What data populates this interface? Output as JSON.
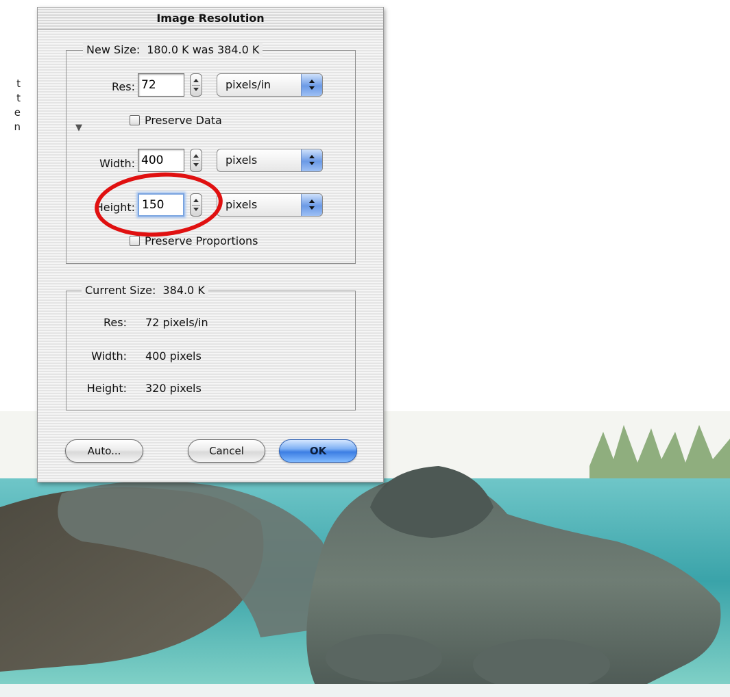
{
  "dialog": {
    "title": "Image Resolution",
    "new_size": {
      "legend_prefix": "New Size:",
      "legend_value": "180.0 K was 384.0 K",
      "res_label": "Res:",
      "res_value": "72",
      "res_unit": "pixels/in",
      "preserve_data_label": "Preserve Data",
      "preserve_data_checked": false,
      "width_label": "Width:",
      "width_value": "400",
      "width_unit": "pixels",
      "height_label": "Height:",
      "height_value": "150",
      "height_unit": "pixels",
      "preserve_proportions_label": "Preserve Proportions",
      "preserve_proportions_checked": false
    },
    "current_size": {
      "legend_prefix": "Current Size:",
      "legend_value": "384.0 K",
      "res_label": "Res:",
      "res_value": "72 pixels/in",
      "width_label": "Width:",
      "width_value": "400 pixels",
      "height_label": "Height:",
      "height_value": "320 pixels"
    },
    "buttons": {
      "auto": "Auto...",
      "cancel": "Cancel",
      "ok": "OK"
    }
  },
  "annotation": {
    "ring_color": "#e01010"
  },
  "stray_text": [
    "t",
    "t",
    "e",
    "n"
  ]
}
